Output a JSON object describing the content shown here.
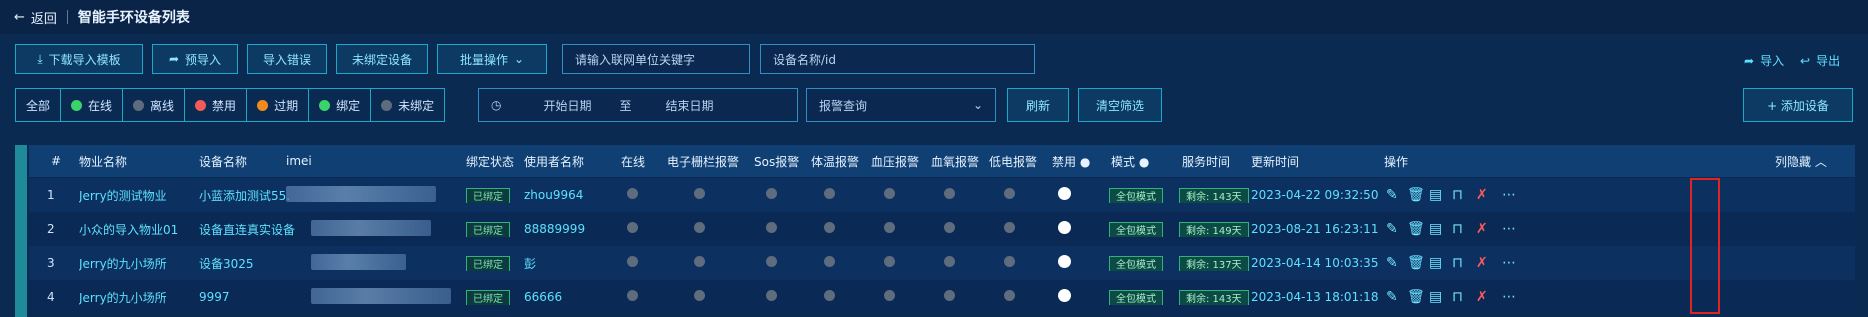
{
  "header": {
    "back_label": "返回",
    "title": "智能手环设备列表"
  },
  "toolbar": {
    "download_template": "下载导入模板",
    "pre_import": "预导入",
    "import_error": "导入错误",
    "unbound_devices": "未绑定设备",
    "batch_ops": "批量操作",
    "unit_placeholder": "请输入联网单位关键字",
    "device_placeholder": "设备名称/id",
    "import_label": "导入",
    "export_label": "导出"
  },
  "filters": {
    "all": "全部",
    "online": "在线",
    "offline": "离线",
    "disabled": "禁用",
    "expired": "过期",
    "bound": "绑定",
    "unbound": "未绑定",
    "start_date": "开始日期",
    "to": "至",
    "end_date": "结束日期",
    "alarm_query": "报警查询",
    "refresh": "刷新",
    "clear": "清空筛选",
    "add_device": "+ 添加设备"
  },
  "colors": {
    "online": "#3ad46a",
    "offline": "#5f6c7e",
    "disabled": "#f05a5a",
    "expired": "#f28a1d",
    "bound": "#3ad46a",
    "unbound": "#5f6c7e"
  },
  "columns": {
    "idx": "#",
    "property": "物业名称",
    "device": "设备名称",
    "imei": "imei",
    "bind_status": "绑定状态",
    "user": "使用者名称",
    "online": "在线",
    "fence": "电子栅栏报警",
    "sos": "Sos报警",
    "temp": "体温报警",
    "bp": "血压报警",
    "spo2": "血氧报警",
    "battery": "低电报警",
    "ban": "禁用",
    "mode": "模式",
    "service_time": "服务时间",
    "update_time": "更新时间",
    "ops": "操作",
    "hide_cols": "列隐藏"
  },
  "rows": [
    {
      "idx": "1",
      "property": "Jerry的测试物业",
      "device": "小蓝添加测试55...",
      "bind": "已绑定",
      "user": "zhou9964",
      "mode": "全包模式",
      "remain": "剩余: 143天",
      "updated": "2023-04-22 09:32:50"
    },
    {
      "idx": "2",
      "property": "小众的导入物业01",
      "device": "设备直连真实设备",
      "bind": "已绑定",
      "user": "88889999",
      "mode": "全包模式",
      "remain": "剩余: 149天",
      "updated": "2023-08-21 16:23:11"
    },
    {
      "idx": "3",
      "property": "Jerry的九小场所",
      "device": "设备3025",
      "bind": "已绑定",
      "user": "彭",
      "mode": "全包模式",
      "remain": "剩余: 137天",
      "updated": "2023-04-14 10:03:35"
    },
    {
      "idx": "4",
      "property": "Jerry的九小场所",
      "device": "9997",
      "bind": "已绑定",
      "user": "66666",
      "mode": "全包模式",
      "remain": "剩余: 143天",
      "updated": "2023-04-13 18:01:18"
    }
  ]
}
